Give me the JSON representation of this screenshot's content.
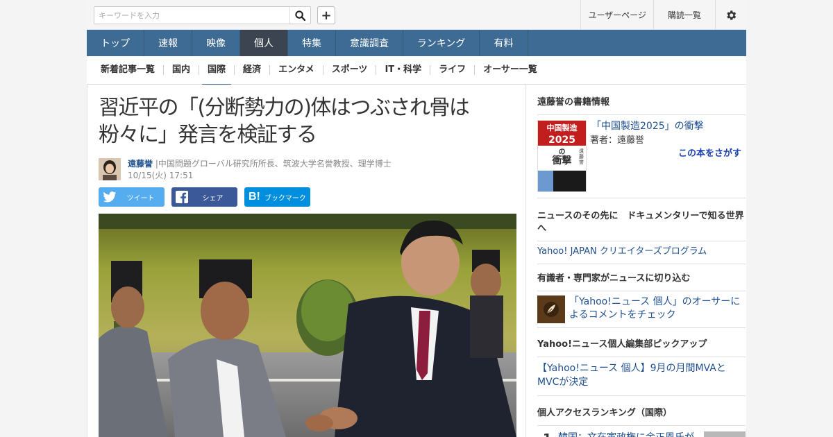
{
  "header": {
    "search_placeholder": "キーワードを入力",
    "user_page": "ユーザーページ",
    "subscriptions": "購読一覧"
  },
  "global_nav": [
    {
      "label": "トップ",
      "active": false
    },
    {
      "label": "速報",
      "active": false
    },
    {
      "label": "映像",
      "active": false
    },
    {
      "label": "個人",
      "active": true
    },
    {
      "label": "特集",
      "active": false
    },
    {
      "label": "意識調査",
      "active": false
    },
    {
      "label": "ランキング",
      "active": false
    },
    {
      "label": "有料",
      "active": false
    }
  ],
  "sub_nav": [
    {
      "label": "新着記事一覧",
      "active": false
    },
    {
      "label": "国内",
      "active": false
    },
    {
      "label": "国際",
      "active": true
    },
    {
      "label": "経済",
      "active": false
    },
    {
      "label": "エンタメ",
      "active": false
    },
    {
      "label": "スポーツ",
      "active": false
    },
    {
      "label": "IT・科学",
      "active": false
    },
    {
      "label": "ライフ",
      "active": false
    },
    {
      "label": "オーサー一覧",
      "active": false
    }
  ],
  "article": {
    "title_line1": "習近平の「(分断勢力の)体はつぶされ骨は",
    "title_line2": "粉々に」発言を検証する",
    "author_name": "遠藤誉",
    "author_title": "|中国問題グローバル研究所所長、筑波大学名誉教授、理学博士",
    "date": "10/15(火) 17:51"
  },
  "share": {
    "tweet": "ツイート",
    "facebook": "シェア",
    "hatena": "ブックマーク",
    "hatena_logo": "B!"
  },
  "sidebar": {
    "book_heading": "遠藤誉の書籍情報",
    "book_title": "「中国製造2025」の衝撃",
    "book_author": "著者：遠藤誉",
    "book_find": "この本をさがす",
    "book_cover": {
      "top": "中国製造",
      "num": "2025",
      "no": "の",
      "name": "衝撃",
      "side": "遠藤誉"
    },
    "doc_heading": "ニュースのその先に　ドキュメンタリーで知る世界へ",
    "doc_link": "Yahoo! JAPAN クリエイターズプログラム",
    "expert_heading": "有識者・専門家がニュースに切り込む",
    "expert_link": "「Yahoo!ニュース 個人」のオーサーによるコメントをチェック",
    "pickup_heading": "Yahoo!ニュース個人編集部ピックアップ",
    "pickup_link": "【Yahoo!ニュース 個人】9月の月間MVAとMVCが決定",
    "ranking_heading": "個人アクセスランキング（国際）",
    "ranking_item": {
      "rank": "1",
      "text": "韓国：文在寅政権に金正恩氏が"
    }
  },
  "colors": {
    "nav_blue": "#3d6b93",
    "nav_active": "#3b4450",
    "link": "#1f4f8f",
    "twitter": "#55acee",
    "facebook": "#3b5998",
    "hatena": "#008fde"
  },
  "icons": [
    "search-icon",
    "plus-icon",
    "gear-icon",
    "twitter-icon",
    "facebook-icon",
    "hatena-icon",
    "quill-icon"
  ]
}
